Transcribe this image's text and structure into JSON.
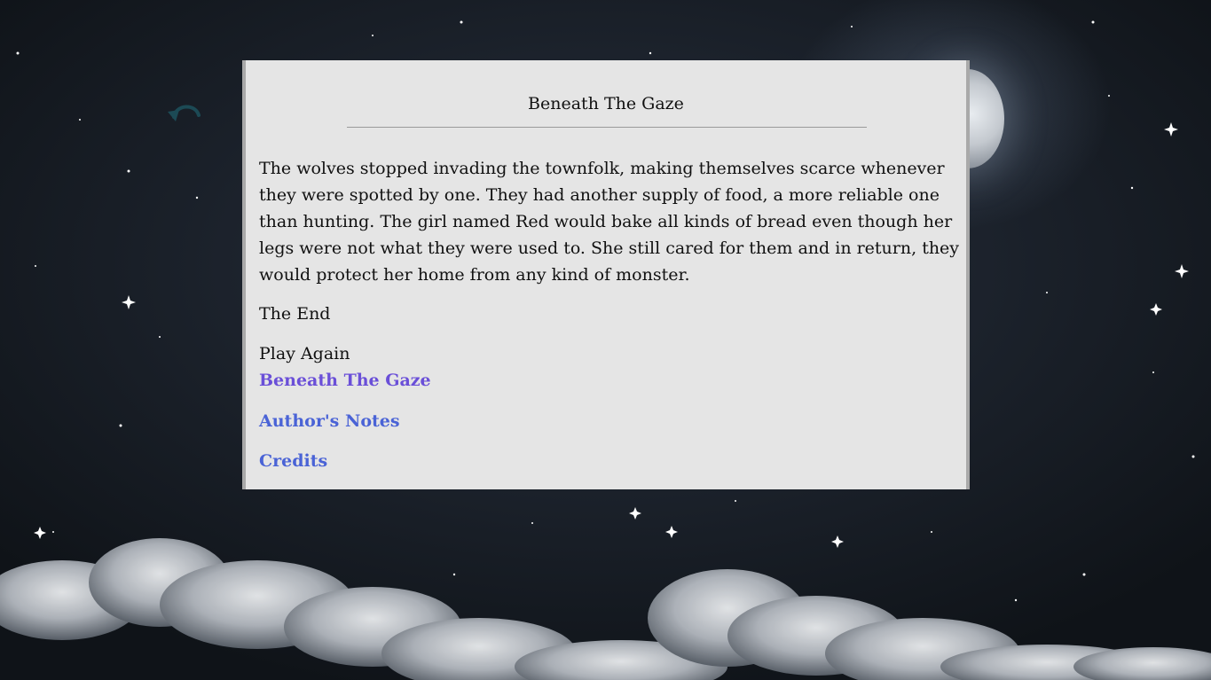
{
  "story": {
    "title": "Beneath The Gaze",
    "paragraph": "The wolves stopped invading the townfolk, making themselves scarce whenever they were spotted by one. They had another supply of food, a more reliable one than hunting. The girl named Red would bake all kinds of bread even though her legs were not what they were used to. She still cared for them and in return, they would protect her home from any kind of monster.",
    "ending": "The End",
    "play_again_label": "Play Again"
  },
  "links": {
    "restart": "Beneath The Gaze",
    "authors_notes": "Author's Notes",
    "credits": "Credits"
  },
  "icons": {
    "back": "undo-arrow-icon"
  },
  "colors": {
    "panel_bg": "#e5e5e5",
    "panel_border": "#a9a9a9",
    "link_visited": "#6a4fd8",
    "link": "#4a63d6",
    "back_icon": "#1c4a55"
  }
}
